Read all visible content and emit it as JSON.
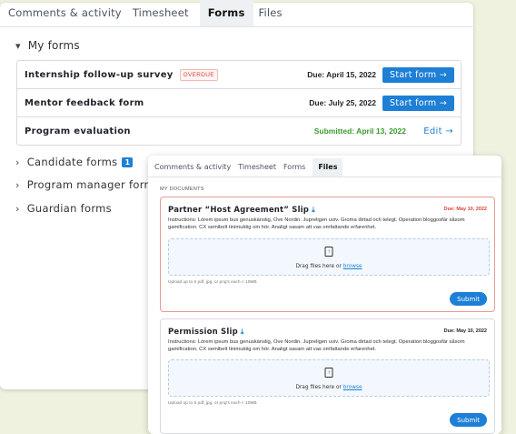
{
  "back_panel": {
    "tabs": [
      "Comments & activity",
      "Timesheet",
      "Forms",
      "Files"
    ],
    "active_tab": "Forms",
    "my_forms_label": "My forms",
    "forms": [
      {
        "name": "Internship follow-up survey",
        "badge": "OVERDUE",
        "status": "Due: April 15, 2022",
        "action": "Start form →"
      },
      {
        "name": "Mentor feedback form",
        "badge": "",
        "status": "Due: July 25, 2022",
        "action": "Start form →"
      },
      {
        "name": "Program evaluation",
        "badge": "",
        "status": "Submitted: April 13, 2022",
        "action": "Edit →"
      }
    ],
    "candidate_forms_label": "Candidate forms",
    "candidate_forms_count": "1",
    "program_manager_forms_label": "Program manager forms",
    "guardian_forms_label": "Guardian forms"
  },
  "front_panel": {
    "tabs": [
      "Comments & activity",
      "Timesheet",
      "Forms",
      "Files"
    ],
    "active_tab": "Files",
    "my_documents_label": "MY DOCUMENTS",
    "documents": [
      {
        "title": "Partner “Host Agreement” Slip",
        "download_icon": "⤓",
        "due": "Due: May 10, 2022",
        "due_color": "#d9443b",
        "instructions": "Instructions: Lörem ipsum bus genuskänslig, Ove Nordin. Jupreligen uviv. Groma dirtad och telegt. Operation bloggosfär såsom gamification. CX semibelt tinimuktig om hör. Analigt sasam att vas omfattande erfarenhet.",
        "drop_text": "Drag files here or",
        "browse_label": "browse",
        "hint": "Upload up to 5 pdf, jpg, or png's each < 10MB",
        "submit_label": "Submit"
      },
      {
        "title": "Permission Slip",
        "download_icon": "⤓",
        "due": "Due: May 10, 2022",
        "due_color": "#1f2329",
        "instructions": "Instructions: Lörem ipsum bus genuskänslig, Ove Nordin. Jupreligen uviv. Groma dirtad och telegt. Operation bloggosfär såsom gamification. CX semibelt tinimuktig om hör. Analigt sasam att vas omfattande erfarenhet.",
        "drop_text": "Drag files here or",
        "browse_label": "browse",
        "hint": "Upload up to 5 pdf, jpg, or png's each < 10MB",
        "submit_label": "Submit"
      }
    ]
  }
}
